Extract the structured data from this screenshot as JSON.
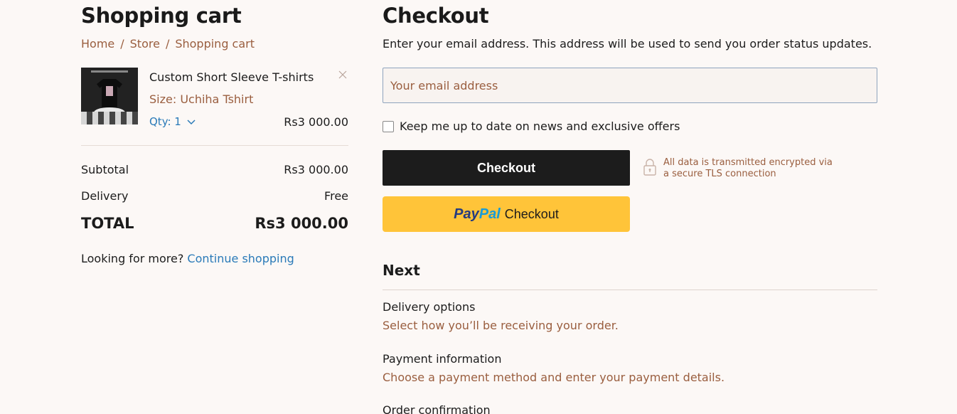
{
  "cart": {
    "title": "Shopping cart",
    "breadcrumb": [
      "Home",
      "Store",
      "Shopping cart"
    ],
    "item": {
      "name": "Custom Short Sleeve T-shirts",
      "size": "Size: Uchiha Tshirt",
      "qty": "Qty: 1",
      "price": "Rs3 000.00",
      "image_text": "#UCHIHASTUDIO"
    },
    "subtotal_label": "Subtotal",
    "subtotal_value": "Rs3 000.00",
    "delivery_label": "Delivery",
    "delivery_value": "Free",
    "total_label": "TOTAL",
    "total_value": "Rs3 000.00",
    "more_text": "Looking for more?",
    "continue_link": "Continue shopping"
  },
  "checkout": {
    "title": "Checkout",
    "intro": "Enter your email address. This address will be used to send you order status updates.",
    "email_placeholder": "Your email address",
    "newsletter_label": "Keep me up to date on news and exclusive offers",
    "checkout_button": "Checkout",
    "paypal_logo_part1": "Pay",
    "paypal_logo_part2": "Pal",
    "paypal_button_text": "Checkout",
    "secure_line1": "All data is transmitted encrypted via",
    "secure_line2": "a secure TLS connection"
  },
  "next": {
    "title": "Next",
    "steps": [
      {
        "title": "Delivery options",
        "desc": "Select how you’ll be receiving your order."
      },
      {
        "title": "Payment information",
        "desc": "Choose a payment method and enter your payment details."
      },
      {
        "title": "Order confirmation",
        "desc": ""
      }
    ]
  },
  "colors": {
    "background": "#fcf8f6",
    "accent_brown": "#9a5e3f",
    "link_blue": "#2a7ab8",
    "checkout_button": "#1c1c1c",
    "paypal_button": "#ffc439"
  },
  "icons": [
    "close-icon",
    "chevron-down-icon",
    "lock-icon"
  ]
}
